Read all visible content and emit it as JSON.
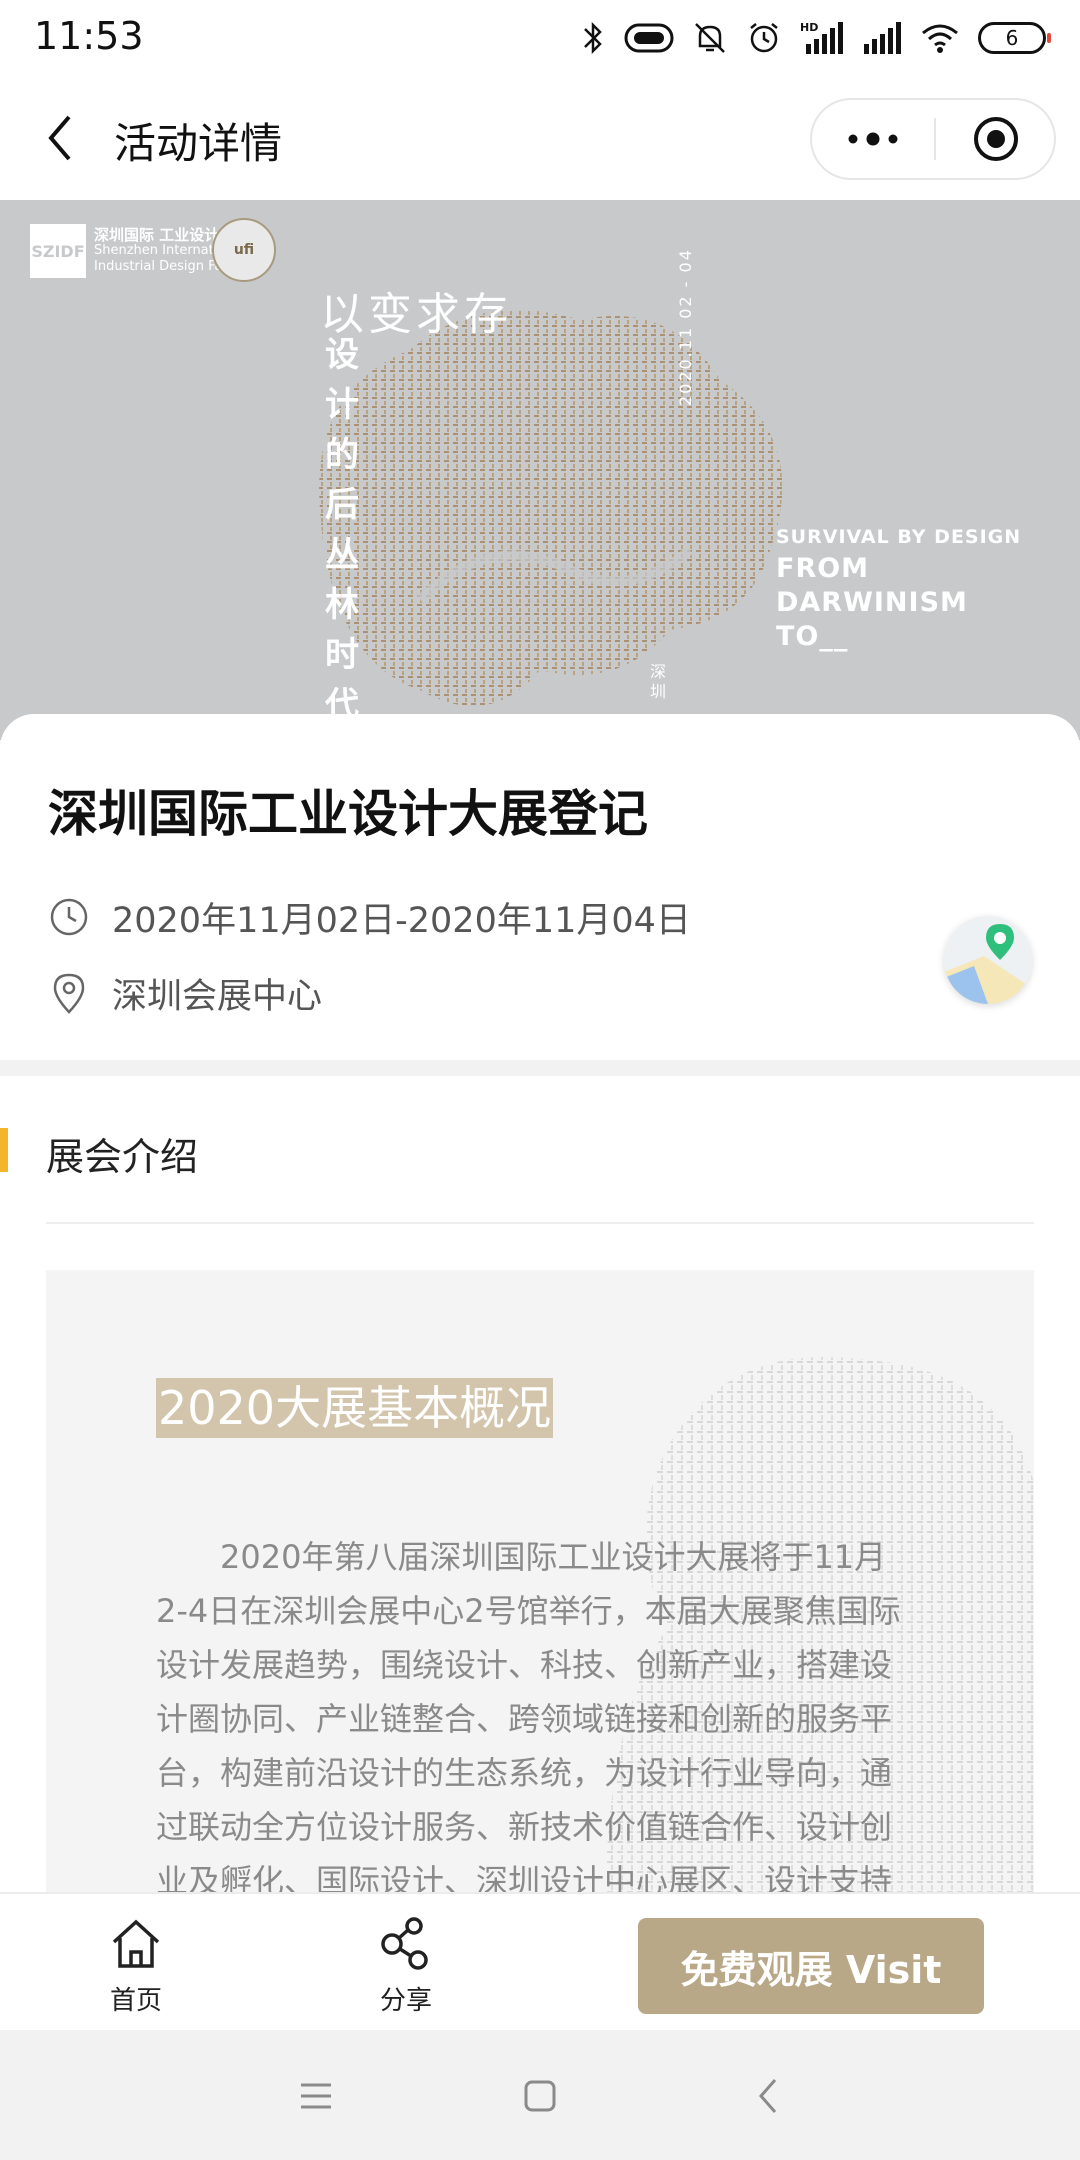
{
  "status_bar": {
    "time": "11:53",
    "battery": "6"
  },
  "nav": {
    "title": "活动详情"
  },
  "banner": {
    "logo_mark": "SZIDF",
    "logo_cn": "深圳国际 工业设计大展",
    "logo_en_1": "Shenzhen International",
    "logo_en_2": "Industrial Design Fair",
    "ufi": "ufi",
    "slogan": "以变求存",
    "vertical_text": "设计的后丛林时代",
    "date_vertical": "2020.11 02 - 04",
    "en_small": "SURVIVAL BY DESIGN",
    "en_big": "FROM\nDARWINISM\nTO__",
    "vertical_city": "深圳"
  },
  "event": {
    "title": "深圳国际工业设计大展登记",
    "date": "2020年11月02日-2020年11月04日",
    "venue": "深圳会展中心"
  },
  "intro": {
    "heading": "展会介绍",
    "tag": "2020大展基本概况",
    "paragraph": "2020年第八届深圳国际工业设计大展将于11月2-4日在深圳会展中心2号馆举行，本届大展聚焦国际设计发展趋势，围绕设计、科技、创新产业，搭建设计圈协同、产业链整合、跨领域链接和创新的服务平台，构建前沿设计的生态系统，为设计行业导向，通过联动全方位设计服务、新技术价值链合作、设计创业及孵化、国际设计、深圳设计中心展区、设计支持"
  },
  "bottom": {
    "home_label": "首页",
    "share_label": "分享",
    "visit_label": "免费观展 Visit"
  },
  "colors": {
    "accent_gold": "#b9a888",
    "section_marker": "#f3b62a",
    "banner_bg": "#c7c9cb"
  }
}
